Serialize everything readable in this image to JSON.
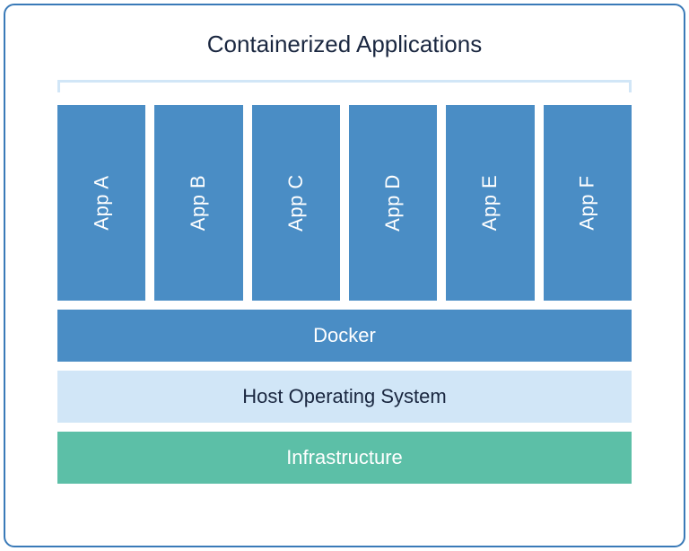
{
  "title": "Containerized Applications",
  "apps": [
    {
      "label": "App A"
    },
    {
      "label": "App B"
    },
    {
      "label": "App C"
    },
    {
      "label": "App D"
    },
    {
      "label": "App E"
    },
    {
      "label": "App F"
    }
  ],
  "layers": {
    "docker": "Docker",
    "hostos": "Host Operating System",
    "infra": "Infrastructure"
  },
  "colors": {
    "appBlue": "#4a8dc5",
    "lightBlue": "#d1e6f7",
    "teal": "#5cbfa7",
    "border": "#3a7ab8",
    "titleText": "#1a2740"
  }
}
